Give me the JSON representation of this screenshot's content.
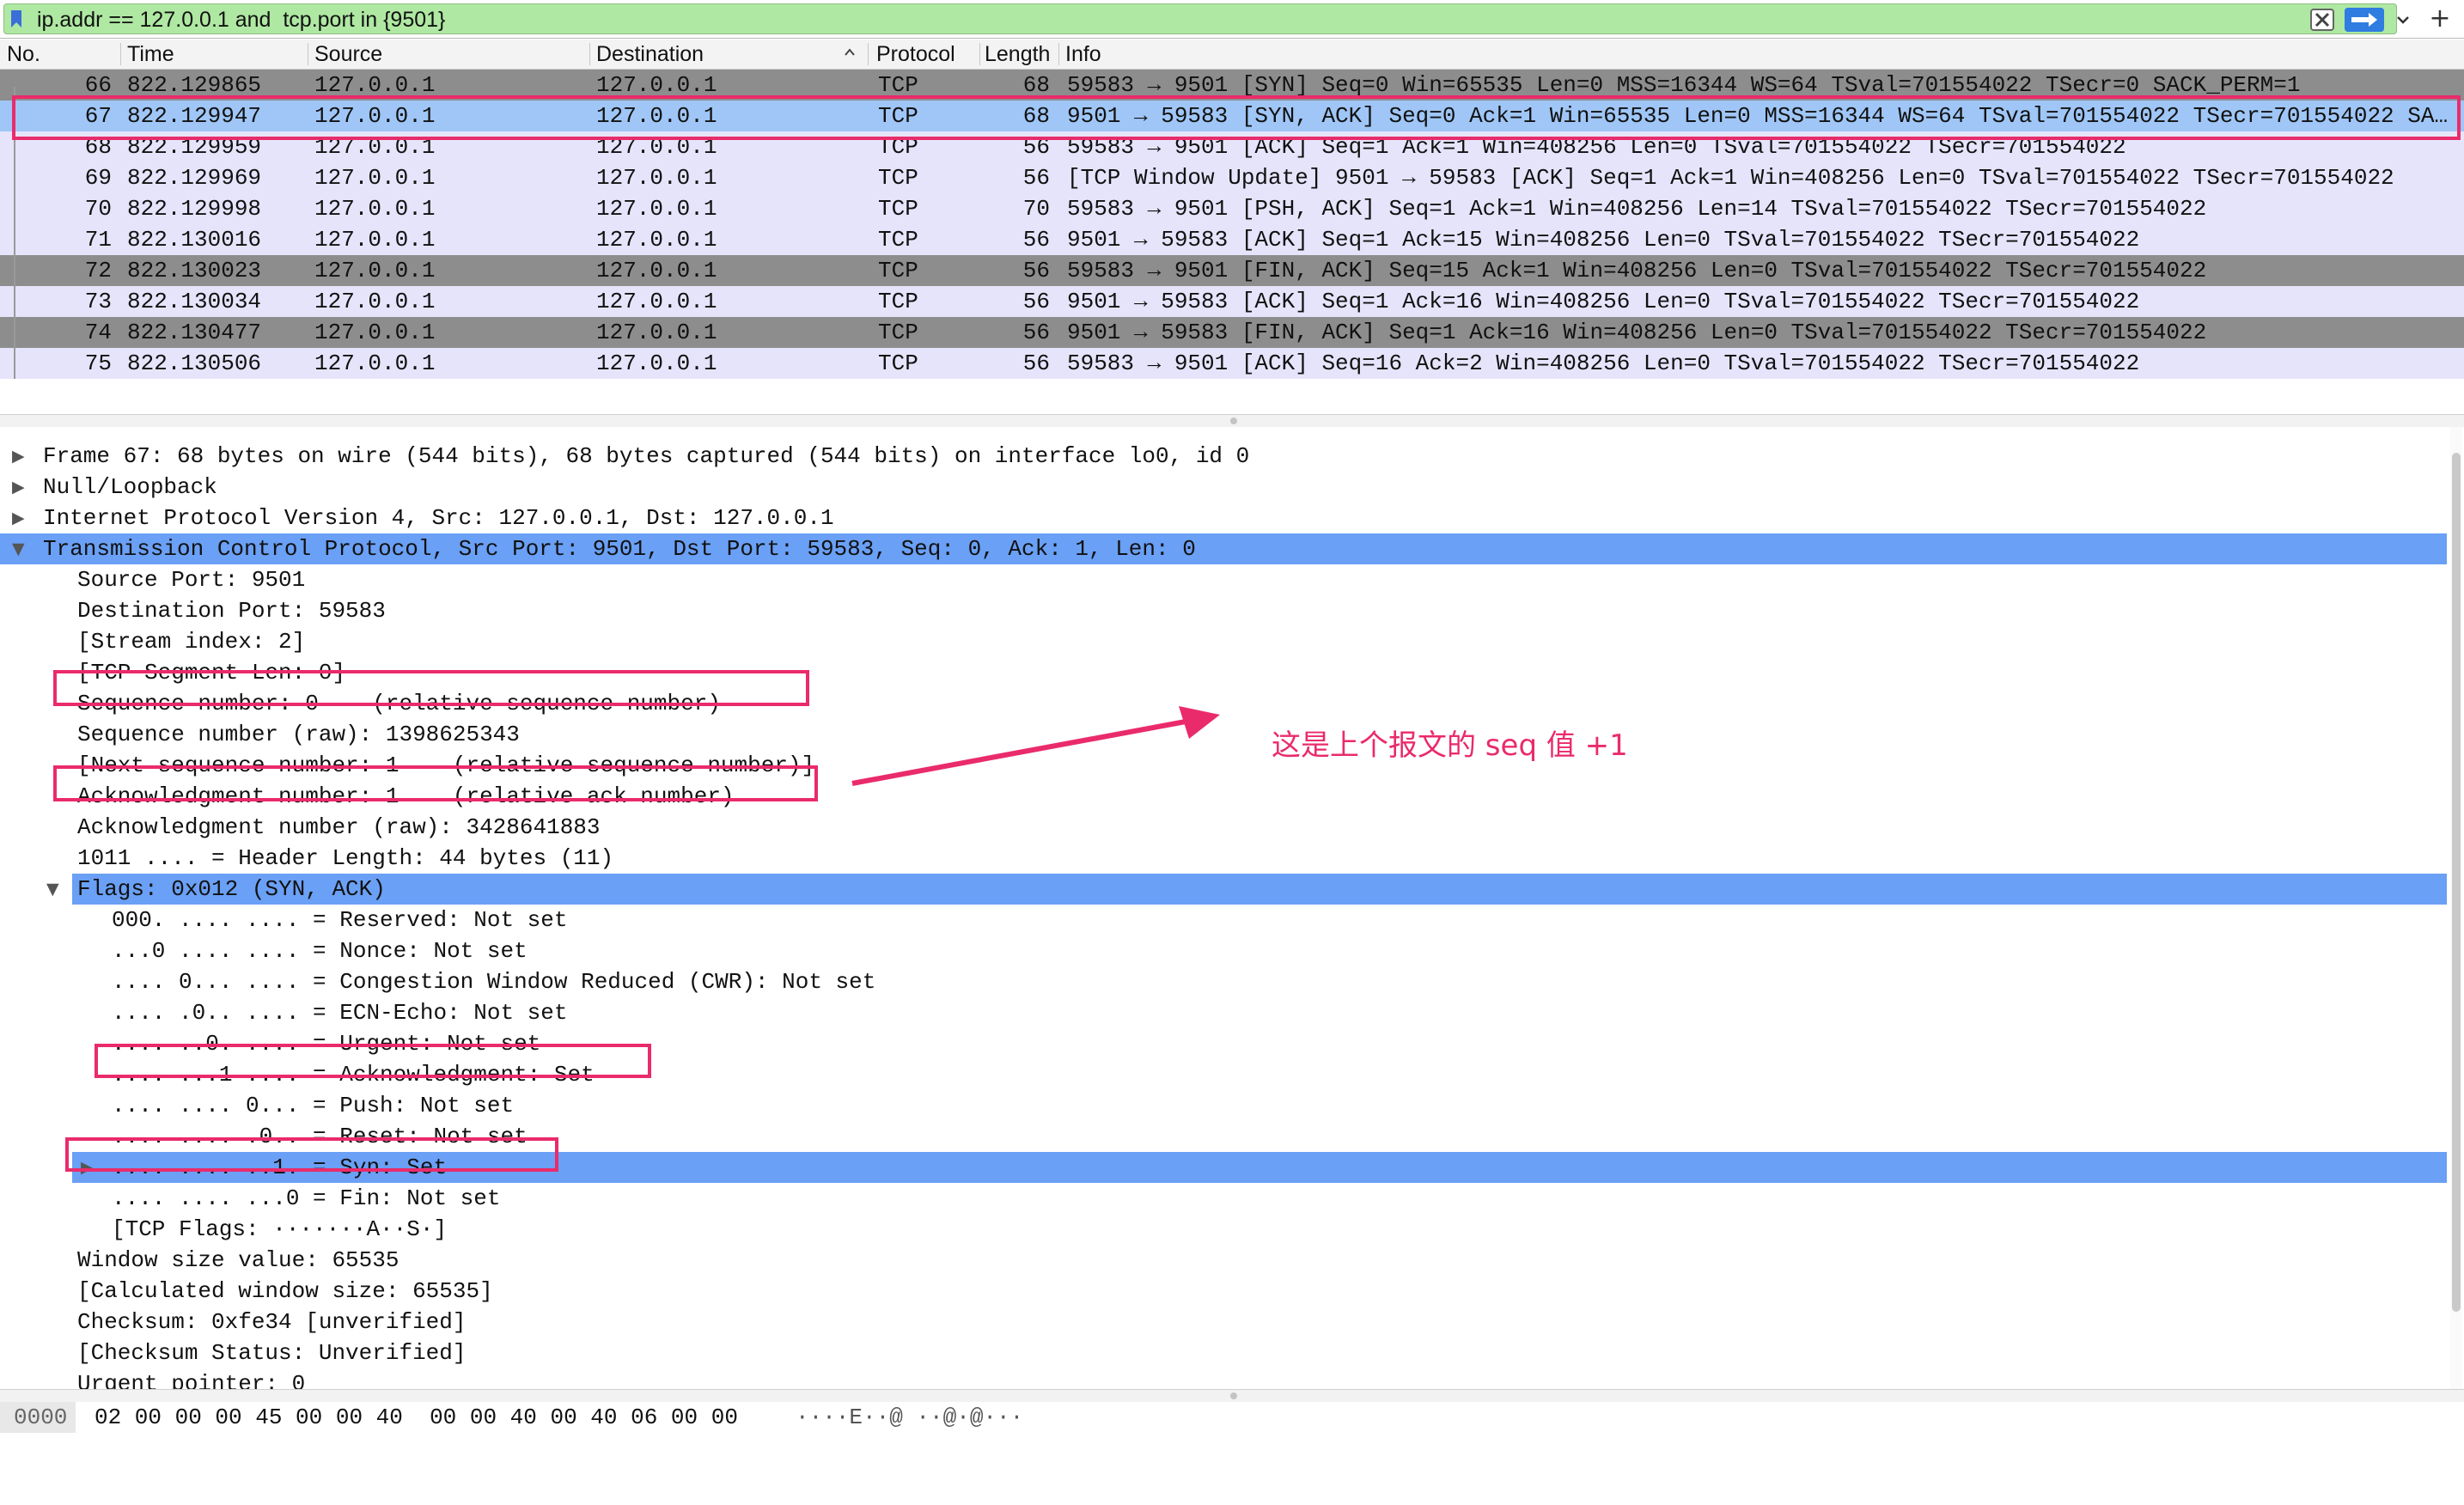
{
  "filter": {
    "text": "ip.addr == 127.0.0.1 and  tcp.port in {9501}"
  },
  "columns": {
    "no": "No.",
    "time": "Time",
    "source": "Source",
    "destination": "Destination",
    "protocol": "Protocol",
    "length": "Length",
    "info": "Info"
  },
  "packets": [
    {
      "no": "66",
      "time": "822.129865",
      "src": "127.0.0.1",
      "dst": "127.0.0.1",
      "proto": "TCP",
      "len": "68",
      "info": "59583 → 9501 [SYN] Seq=0 Win=65535 Len=0 MSS=16344 WS=64 TSval=701554022 TSecr=0 SACK_PERM=1",
      "bg": "#8d8d8d",
      "fg": "#111111"
    },
    {
      "no": "67",
      "time": "822.129947",
      "src": "127.0.0.1",
      "dst": "127.0.0.1",
      "proto": "TCP",
      "len": "68",
      "info": "9501 → 59583 [SYN, ACK] Seq=0 Ack=1 Win=65535 Len=0 MSS=16344 WS=64 TSval=701554022 TSecr=701554022 SA…",
      "bg": "#9fc6f6",
      "fg": "#111111"
    },
    {
      "no": "68",
      "time": "822.129959",
      "src": "127.0.0.1",
      "dst": "127.0.0.1",
      "proto": "TCP",
      "len": "56",
      "info": "59583 → 9501 [ACK] Seq=1 Ack=1 Win=408256 Len=0 TSval=701554022 TSecr=701554022",
      "bg": "#e6e4fb",
      "fg": "#111111"
    },
    {
      "no": "69",
      "time": "822.129969",
      "src": "127.0.0.1",
      "dst": "127.0.0.1",
      "proto": "TCP",
      "len": "56",
      "info": "[TCP Window Update] 9501 → 59583 [ACK] Seq=1 Ack=1 Win=408256 Len=0 TSval=701554022 TSecr=701554022",
      "bg": "#e6e4fb",
      "fg": "#111111"
    },
    {
      "no": "70",
      "time": "822.129998",
      "src": "127.0.0.1",
      "dst": "127.0.0.1",
      "proto": "TCP",
      "len": "70",
      "info": "59583 → 9501 [PSH, ACK] Seq=1 Ack=1 Win=408256 Len=14 TSval=701554022 TSecr=701554022",
      "bg": "#e6e4fb",
      "fg": "#111111"
    },
    {
      "no": "71",
      "time": "822.130016",
      "src": "127.0.0.1",
      "dst": "127.0.0.1",
      "proto": "TCP",
      "len": "56",
      "info": "9501 → 59583 [ACK] Seq=1 Ack=15 Win=408256 Len=0 TSval=701554022 TSecr=701554022",
      "bg": "#e6e4fb",
      "fg": "#111111"
    },
    {
      "no": "72",
      "time": "822.130023",
      "src": "127.0.0.1",
      "dst": "127.0.0.1",
      "proto": "TCP",
      "len": "56",
      "info": "59583 → 9501 [FIN, ACK] Seq=15 Ack=1 Win=408256 Len=0 TSval=701554022 TSecr=701554022",
      "bg": "#8d8d8d",
      "fg": "#111111"
    },
    {
      "no": "73",
      "time": "822.130034",
      "src": "127.0.0.1",
      "dst": "127.0.0.1",
      "proto": "TCP",
      "len": "56",
      "info": "9501 → 59583 [ACK] Seq=1 Ack=16 Win=408256 Len=0 TSval=701554022 TSecr=701554022",
      "bg": "#e6e4fb",
      "fg": "#111111"
    },
    {
      "no": "74",
      "time": "822.130477",
      "src": "127.0.0.1",
      "dst": "127.0.0.1",
      "proto": "TCP",
      "len": "56",
      "info": "9501 → 59583 [FIN, ACK] Seq=1 Ack=16 Win=408256 Len=0 TSval=701554022 TSecr=701554022",
      "bg": "#8d8d8d",
      "fg": "#111111"
    },
    {
      "no": "75",
      "time": "822.130506",
      "src": "127.0.0.1",
      "dst": "127.0.0.1",
      "proto": "TCP",
      "len": "56",
      "info": "59583 → 9501 [ACK] Seq=16 Ack=2 Win=408256 Len=0 TSval=701554022 TSecr=701554022",
      "bg": "#e6e4fb",
      "fg": "#111111"
    }
  ],
  "details": [
    {
      "text": "Frame 67: 68 bytes on wire (544 bits), 68 bytes captured (544 bits) on interface lo0, id 0",
      "tri": "▶",
      "sel": false
    },
    {
      "text": "Null/Loopback",
      "tri": "▶",
      "sel": false
    },
    {
      "text": "Internet Protocol Version 4, Src: 127.0.0.1, Dst: 127.0.0.1",
      "tri": "▶",
      "sel": false
    },
    {
      "text": "Transmission Control Protocol, Src Port: 9501, Dst Port: 59583, Seq: 0, Ack: 1, Len: 0",
      "tri": "▼",
      "sel": true
    },
    {
      "text": "Source Port: 9501",
      "tri": "",
      "sel": false
    },
    {
      "text": "Destination Port: 59583",
      "tri": "",
      "sel": false
    },
    {
      "text": "[Stream index: 2]",
      "tri": "",
      "sel": false
    },
    {
      "text": "[TCP Segment Len: 0]",
      "tri": "",
      "sel": false
    },
    {
      "text": "Sequence number: 0    (relative sequence number)",
      "tri": "",
      "sel": false
    },
    {
      "text": "Sequence number (raw): 1398625343",
      "tri": "",
      "sel": false
    },
    {
      "text": "[Next sequence number: 1    (relative sequence number)]",
      "tri": "",
      "sel": false
    },
    {
      "text": "Acknowledgment number: 1    (relative ack number)",
      "tri": "",
      "sel": false
    },
    {
      "text": "Acknowledgment number (raw): 3428641883",
      "tri": "",
      "sel": false
    },
    {
      "text": "1011 .... = Header Length: 44 bytes (11)",
      "tri": "",
      "sel": false
    },
    {
      "text": "Flags: 0x012 (SYN, ACK)",
      "tri": "▼",
      "sel": true
    },
    {
      "text": "000. .... .... = Reserved: Not set",
      "tri": "",
      "sel": false
    },
    {
      "text": "...0 .... .... = Nonce: Not set",
      "tri": "",
      "sel": false
    },
    {
      "text": ".... 0... .... = Congestion Window Reduced (CWR): Not set",
      "tri": "",
      "sel": false
    },
    {
      "text": ".... .0.. .... = ECN-Echo: Not set",
      "tri": "",
      "sel": false
    },
    {
      "text": ".... ..0. .... = Urgent: Not set",
      "tri": "",
      "sel": false
    },
    {
      "text": ".... ...1 .... = Acknowledgment: Set",
      "tri": "",
      "sel": false
    },
    {
      "text": ".... .... 0... = Push: Not set",
      "tri": "",
      "sel": false
    },
    {
      "text": ".... .... .0.. = Reset: Not set",
      "tri": "",
      "sel": false
    },
    {
      "text": ".... .... ..1. = Syn: Set",
      "tri": "▶",
      "sel": true
    },
    {
      "text": ".... .... ...0 = Fin: Not set",
      "tri": "",
      "sel": false
    },
    {
      "text": "[TCP Flags: ·······A··S·]",
      "tri": "",
      "sel": false
    },
    {
      "text": "Window size value: 65535",
      "tri": "",
      "sel": false
    },
    {
      "text": "[Calculated window size: 65535]",
      "tri": "",
      "sel": false
    },
    {
      "text": "Checksum: 0xfe34 [unverified]",
      "tri": "",
      "sel": false
    },
    {
      "text": "[Checksum Status: Unverified]",
      "tri": "",
      "sel": false
    },
    {
      "text": "Urgent pointer: 0",
      "tri": "",
      "sel": false
    }
  ],
  "bytes": {
    "offset": "0000",
    "hex": "02 00 00 00 45 00 00 40  00 00 40 00 40 06 00 00",
    "ascii": "····E··@ ··@·@···"
  },
  "annotation": {
    "text": "这是上个报文的 seq 值 +1",
    "color": "#ea2b6b"
  },
  "colors": {
    "filter_ok": "#afe8a2",
    "selected_row": "#9fc6f6",
    "detail_selected": "#6aa0f5",
    "highlight": "#ea2b6b"
  }
}
